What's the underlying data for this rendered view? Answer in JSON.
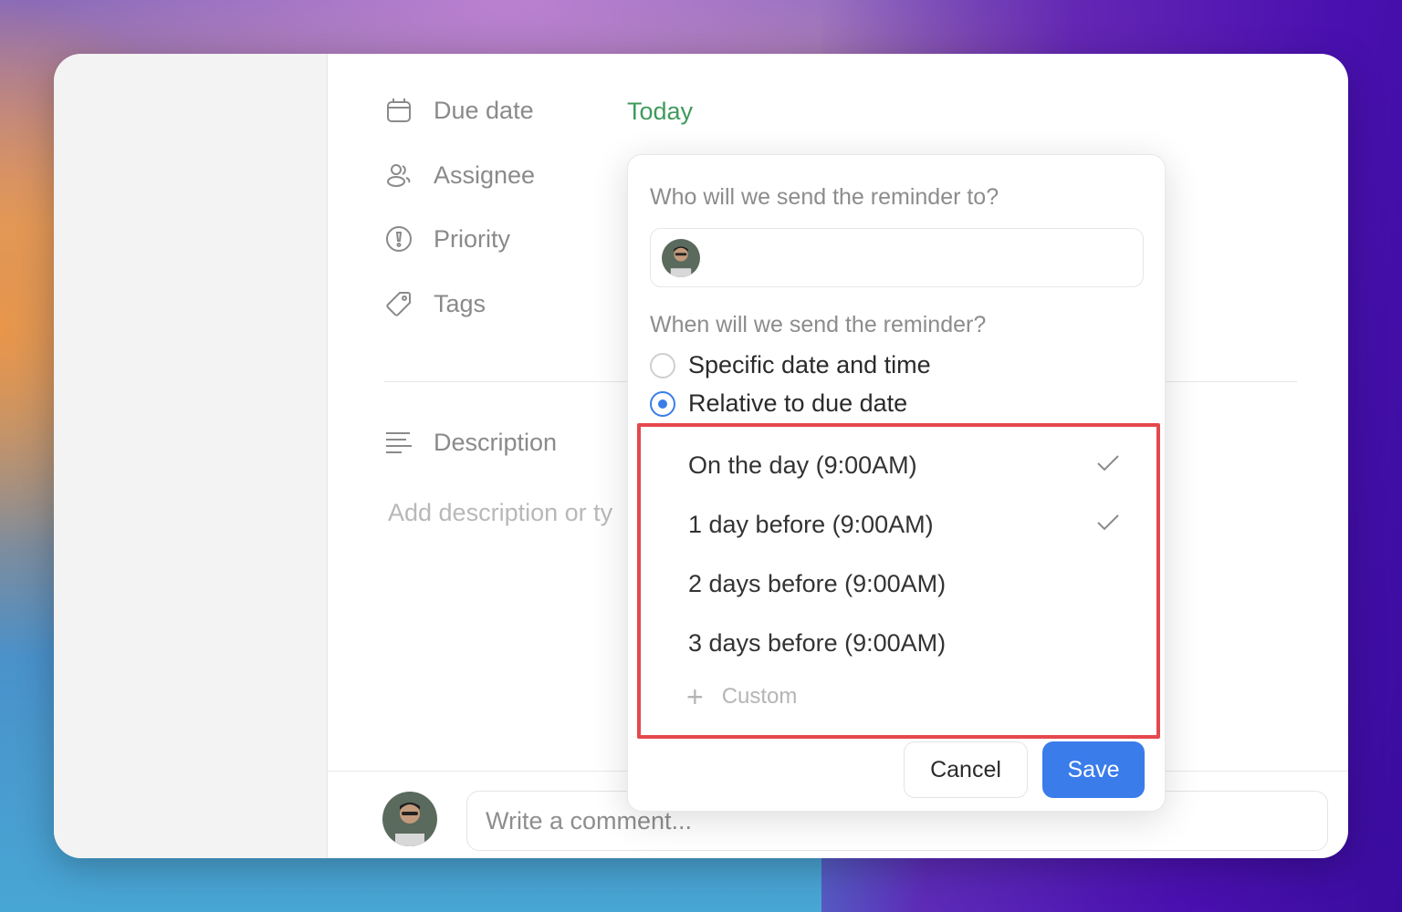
{
  "task_properties": {
    "due_date": {
      "label": "Due date",
      "value": "Today",
      "value_color": "#3f9a5c"
    },
    "assignee": {
      "label": "Assignee"
    },
    "priority": {
      "label": "Priority"
    },
    "tags": {
      "label": "Tags"
    },
    "description": {
      "label": "Description",
      "placeholder": "Add description or ty"
    }
  },
  "reminder_popup": {
    "recipient_question": "Who will we send the reminder to?",
    "timing_question": "When will we send the reminder?",
    "radio_options": [
      {
        "label": "Specific date and time",
        "checked": false
      },
      {
        "label": "Relative to due date",
        "checked": true
      }
    ],
    "relative_options": [
      {
        "label": "On the day (9:00AM)",
        "selected": true
      },
      {
        "label": "1 day before (9:00AM)",
        "selected": true
      },
      {
        "label": "2 days before (9:00AM)",
        "selected": false
      },
      {
        "label": "3 days before (9:00AM)",
        "selected": false
      }
    ],
    "custom_label": "Custom",
    "cancel_label": "Cancel",
    "save_label": "Save",
    "accent_color": "#3a7cea",
    "highlight_color": "#e5484d"
  },
  "comment": {
    "placeholder": "Write a comment..."
  }
}
